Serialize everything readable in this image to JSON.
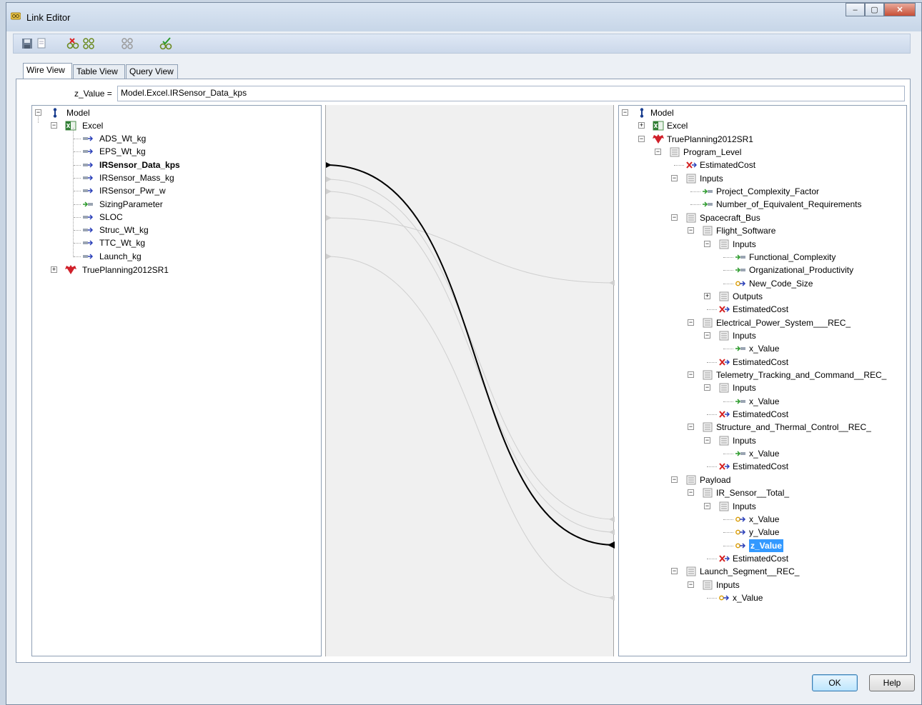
{
  "window": {
    "title": "Link Editor",
    "buttons": {
      "minimize": "–",
      "maximize": "▢",
      "close": "✕"
    }
  },
  "toolbar": {
    "items": [
      "save-icon",
      "copy-icon",
      "unlink-icon",
      "link-pair-icon",
      "link-all-icon",
      "link-check-icon"
    ]
  },
  "tabs": [
    {
      "label": "Wire View",
      "active": true
    },
    {
      "label": "Table View",
      "active": false
    },
    {
      "label": "Query View",
      "active": false
    }
  ],
  "formula": {
    "label": "z_Value =",
    "value": "Model.Excel.IRSensor_Data_kps"
  },
  "left_tree": {
    "root": "Model",
    "excel": "Excel",
    "items": [
      {
        "label": "ADS_Wt_kg",
        "type": "output"
      },
      {
        "label": "EPS_Wt_kg",
        "type": "output"
      },
      {
        "label": "IRSensor_Data_kps",
        "type": "output",
        "bold": true
      },
      {
        "label": "IRSensor_Mass_kg",
        "type": "output"
      },
      {
        "label": "IRSensor_Pwr_w",
        "type": "output"
      },
      {
        "label": "SizingParameter",
        "type": "input"
      },
      {
        "label": "SLOC",
        "type": "output"
      },
      {
        "label": "Struc_Wt_kg",
        "type": "output"
      },
      {
        "label": "TTC_Wt_kg",
        "type": "output"
      },
      {
        "label": "Launch_kg",
        "type": "output"
      }
    ],
    "trueplanning": "TruePlanning2012SR1"
  },
  "right_tree": [
    {
      "label": "Model",
      "icon": "model",
      "level": 0,
      "exp": "-"
    },
    {
      "label": "Excel",
      "icon": "excel",
      "level": 1,
      "exp": "+"
    },
    {
      "label": "TruePlanning2012SR1",
      "icon": "tp",
      "level": 1,
      "exp": "-"
    },
    {
      "label": "Program_Level",
      "icon": "folder",
      "level": 2,
      "exp": "-"
    },
    {
      "label": "EstimatedCost",
      "icon": "cost",
      "level": 3
    },
    {
      "label": "Inputs",
      "icon": "folder",
      "level": 3,
      "exp": "-"
    },
    {
      "label": "Project_Complexity_Factor",
      "icon": "input",
      "level": 4
    },
    {
      "label": "Number_of_Equivalent_Requirements",
      "icon": "input",
      "level": 4
    },
    {
      "label": "Spacecraft_Bus",
      "icon": "folder",
      "level": 3,
      "exp": "-"
    },
    {
      "label": "Flight_Software",
      "icon": "folder",
      "level": 4,
      "exp": "-"
    },
    {
      "label": "Inputs",
      "icon": "folder",
      "level": 5,
      "exp": "-"
    },
    {
      "label": "Functional_Complexity",
      "icon": "input",
      "level": 6
    },
    {
      "label": "Organizational_Productivity",
      "icon": "input",
      "level": 6
    },
    {
      "label": "New_Code_Size",
      "icon": "linked",
      "level": 6
    },
    {
      "label": "Outputs",
      "icon": "folder",
      "level": 5,
      "exp": "+"
    },
    {
      "label": "EstimatedCost",
      "icon": "cost",
      "level": 5
    },
    {
      "label": "Electrical_Power_System___REC_",
      "icon": "folder",
      "level": 4,
      "exp": "-"
    },
    {
      "label": "Inputs",
      "icon": "folder",
      "level": 5,
      "exp": "-"
    },
    {
      "label": "x_Value",
      "icon": "input",
      "level": 6
    },
    {
      "label": "EstimatedCost",
      "icon": "cost",
      "level": 5
    },
    {
      "label": "Telemetry_Tracking_and_Command__REC_",
      "icon": "folder",
      "level": 4,
      "exp": "-"
    },
    {
      "label": "Inputs",
      "icon": "folder",
      "level": 5,
      "exp": "-"
    },
    {
      "label": "x_Value",
      "icon": "input",
      "level": 6
    },
    {
      "label": "EstimatedCost",
      "icon": "cost",
      "level": 5
    },
    {
      "label": "Structure_and_Thermal_Control__REC_",
      "icon": "folder",
      "level": 4,
      "exp": "-"
    },
    {
      "label": "Inputs",
      "icon": "folder",
      "level": 5,
      "exp": "-"
    },
    {
      "label": "x_Value",
      "icon": "input",
      "level": 6
    },
    {
      "label": "EstimatedCost",
      "icon": "cost",
      "level": 5
    },
    {
      "label": "Payload",
      "icon": "folder",
      "level": 3,
      "exp": "-"
    },
    {
      "label": "IR_Sensor__Total_",
      "icon": "folder",
      "level": 4,
      "exp": "-"
    },
    {
      "label": "Inputs",
      "icon": "folder",
      "level": 5,
      "exp": "-"
    },
    {
      "label": "x_Value",
      "icon": "linked",
      "level": 6
    },
    {
      "label": "y_Value",
      "icon": "linked",
      "level": 6
    },
    {
      "label": "z_Value",
      "icon": "linked",
      "level": 6,
      "selected": true
    },
    {
      "label": "EstimatedCost",
      "icon": "cost",
      "level": 5
    },
    {
      "label": "Launch_Segment__REC_",
      "icon": "folder",
      "level": 3,
      "exp": "-"
    },
    {
      "label": "Inputs",
      "icon": "folder",
      "level": 4,
      "exp": "-"
    },
    {
      "label": "x_Value",
      "icon": "linked",
      "level": 5
    }
  ],
  "buttons": {
    "ok": "OK",
    "help": "Help"
  }
}
